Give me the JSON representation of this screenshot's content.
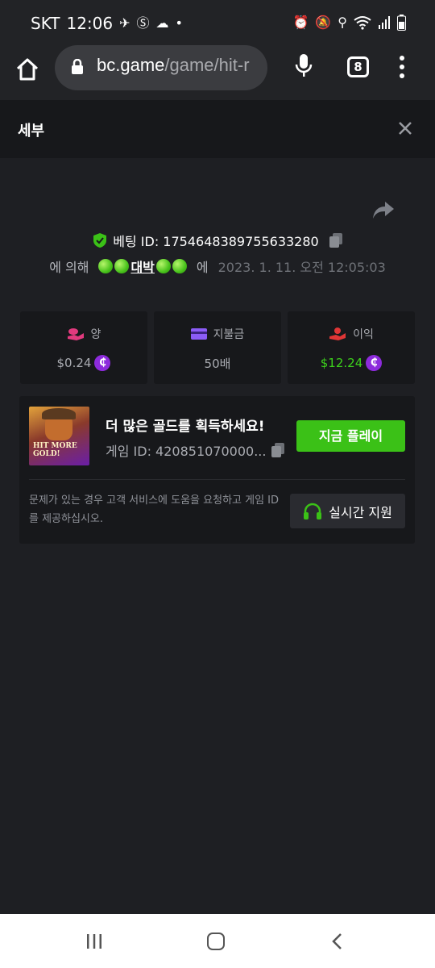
{
  "status_bar": {
    "carrier": "SKT",
    "time": "12:06",
    "icons": [
      "bluetooth-icon",
      "s-icon",
      "cloud-icon",
      "dot-icon"
    ],
    "right_icons": [
      "alarm-icon",
      "mute-icon",
      "location-icon",
      "wifi-icon",
      "signal-icon",
      "battery-icon"
    ]
  },
  "browser": {
    "url_host": "bc.game",
    "url_path": "/game/hit-r",
    "tab_count": "8"
  },
  "header": {
    "title": "세부"
  },
  "bet": {
    "id_text": "베팅 ID: 1754648389755633280",
    "by_label": "에 의해",
    "username": "대박",
    "at_label": "에",
    "date": "2023. 1. 11. 오전 12:05:03"
  },
  "stats": [
    {
      "label": "양",
      "value": "$0.24",
      "icon": "coins-hand-icon",
      "has_coin": true,
      "color": "#e23a7e"
    },
    {
      "label": "지불금",
      "value": "50배",
      "icon": "card-icon",
      "has_coin": false,
      "color": "#8b5cf6"
    },
    {
      "label": "이익",
      "value": "$12.24",
      "icon": "profit-hand-icon",
      "has_coin": true,
      "color": "#e03636"
    }
  ],
  "game": {
    "title": "더 많은 골드를 획득하세요!",
    "game_id": "게임 ID: 420851070000...",
    "play_label": "지금 플레이",
    "thumb_text": "HIT MORE GOLD!",
    "help_text": "문제가 있는 경우 고객 서비스에 도움을 요청하고 게임 ID를 제공하십시오.",
    "live_support_label": "실시간 지원"
  },
  "colors": {
    "accent_green": "#3bc117",
    "bg": "#1e1f23",
    "panel": "#17181b"
  }
}
